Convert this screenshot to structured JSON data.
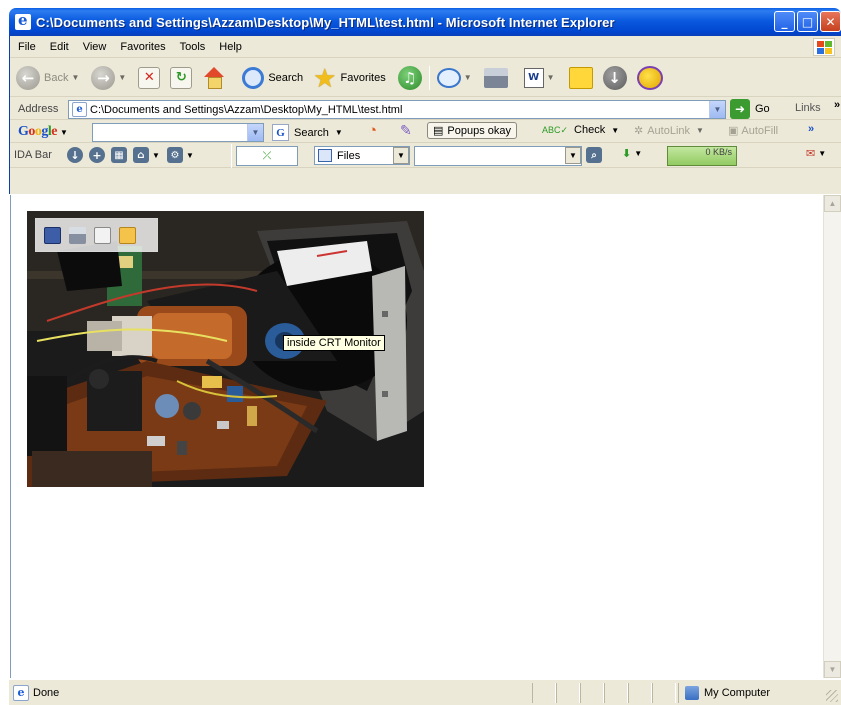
{
  "window": {
    "title": "C:\\Documents and Settings\\Azzam\\Desktop\\My_HTML\\test.html - Microsoft Internet Explorer",
    "minimize": "_",
    "maximize": "□",
    "close": "✕"
  },
  "menu": [
    "File",
    "Edit",
    "View",
    "Favorites",
    "Tools",
    "Help"
  ],
  "toolbar": {
    "back": "Back",
    "search": "Search",
    "favorites": "Favorites",
    "word_glyph": "W"
  },
  "address": {
    "label": "Address",
    "value": "C:\\Documents and Settings\\Azzam\\Desktop\\My_HTML\\test.html",
    "go": "Go",
    "links": "Links",
    "links_chevron": "»"
  },
  "google_bar": {
    "logo": [
      "G",
      "o",
      "o",
      "g",
      "l",
      "e"
    ],
    "search": "Search",
    "popups": "Popups okay",
    "check": "Check",
    "autolink": "AutoLink",
    "autofill": "AutoFill",
    "chevron": "»"
  },
  "ida_bar": {
    "label": "IDA Bar",
    "files": "Files",
    "speed": "0 KB/s"
  },
  "content": {
    "tooltip": "inside CRT Monitor"
  },
  "status": {
    "text": "Done",
    "zone": "My Computer"
  },
  "colors": {
    "titlebar": "#0a5adf",
    "chrome": "#ece9d8",
    "tooltip_bg": "#ffffe1"
  }
}
